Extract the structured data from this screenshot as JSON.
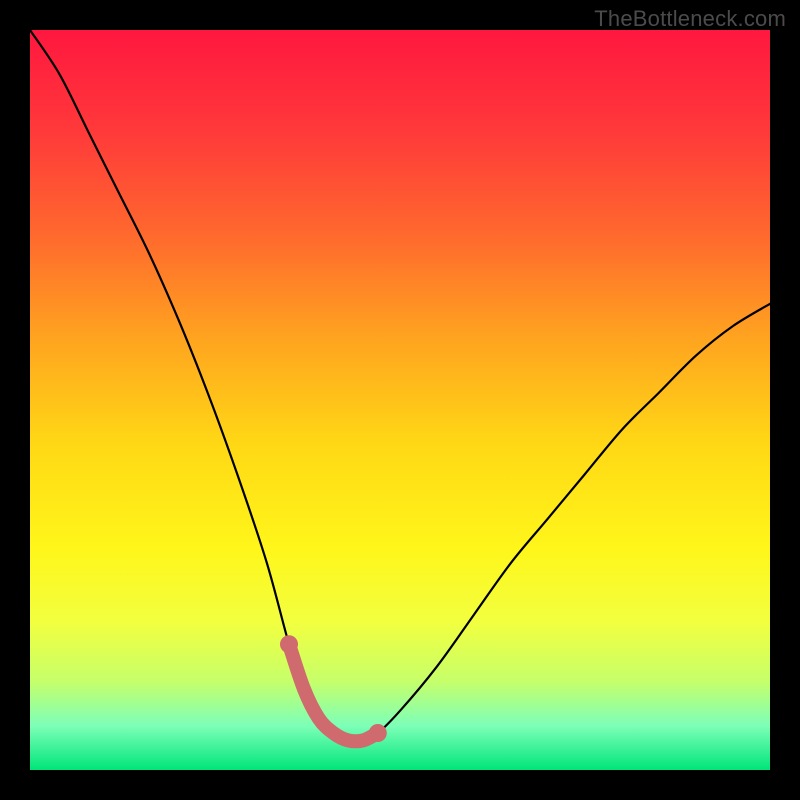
{
  "watermark": "TheBottleneck.com",
  "colors": {
    "frame": "#000000",
    "curve": "#000000",
    "highlight": "#cf6a6e",
    "gradient_stops": [
      {
        "offset": 0.0,
        "color": "#ff173f"
      },
      {
        "offset": 0.14,
        "color": "#ff3a3a"
      },
      {
        "offset": 0.28,
        "color": "#ff6a2d"
      },
      {
        "offset": 0.42,
        "color": "#ffa51f"
      },
      {
        "offset": 0.56,
        "color": "#ffd815"
      },
      {
        "offset": 0.7,
        "color": "#fff61a"
      },
      {
        "offset": 0.8,
        "color": "#f2ff3f"
      },
      {
        "offset": 0.88,
        "color": "#c6ff6a"
      },
      {
        "offset": 0.94,
        "color": "#7dffb8"
      },
      {
        "offset": 1.0,
        "color": "#00e57a"
      }
    ]
  },
  "chart_data": {
    "type": "line",
    "title": "",
    "xlabel": "",
    "ylabel": "",
    "xlim": [
      0,
      100
    ],
    "ylim": [
      0,
      100
    ],
    "note": "Axes unlabeled; values are estimated from pixel positions (0-100 scale, y increases upward).",
    "series": [
      {
        "name": "bottleneck-curve",
        "x": [
          0,
          4,
          8,
          12,
          16,
          20,
          24,
          28,
          32,
          35,
          37,
          39,
          41,
          43,
          45,
          47,
          50,
          55,
          60,
          65,
          70,
          75,
          80,
          85,
          90,
          95,
          100
        ],
        "y": [
          100,
          94,
          86,
          78,
          70,
          61,
          51,
          40,
          28,
          17,
          11,
          7,
          5,
          4,
          4,
          5,
          8,
          14,
          21,
          28,
          34,
          40,
          46,
          51,
          56,
          60,
          63
        ]
      },
      {
        "name": "highlight-segment",
        "x": [
          35,
          37,
          39,
          41,
          43,
          45,
          47
        ],
        "y": [
          17,
          11,
          7,
          5,
          4,
          4,
          5
        ]
      }
    ],
    "highlight_markers": {
      "x": [
        35,
        47
      ],
      "y": [
        17,
        5
      ]
    }
  }
}
